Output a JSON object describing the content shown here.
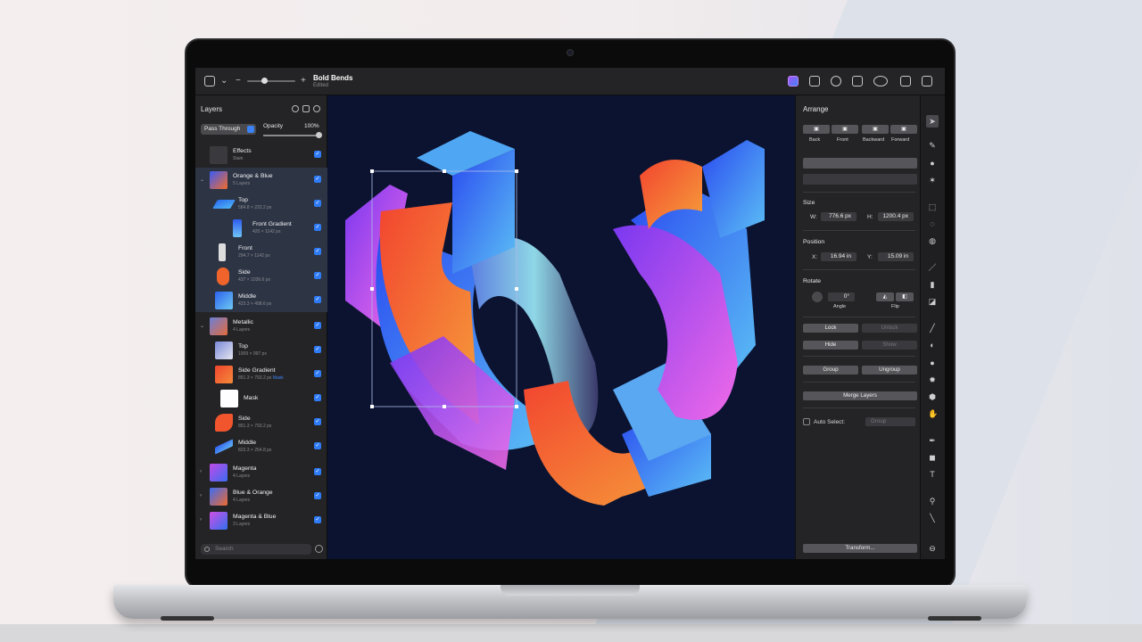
{
  "toolbar": {
    "doc_title": "Bold Bends",
    "doc_status": "Edited"
  },
  "layers_panel": {
    "header": "Layers",
    "blend_mode": "Pass Through",
    "opacity_label": "Opacity",
    "opacity_value": "100%",
    "search_placeholder": "Search",
    "items": [
      {
        "name": "Effects",
        "sub": "Stain"
      },
      {
        "name": "Orange & Blue",
        "sub": "5 Layers"
      },
      {
        "name": "Top",
        "sub": "584.8 × 222.2 px"
      },
      {
        "name": "Front Gradient",
        "sub": "420 × 1142 px"
      },
      {
        "name": "Front",
        "sub": "294.7 × 1142 px"
      },
      {
        "name": "Side",
        "sub": "437 × 1036.6 px"
      },
      {
        "name": "Middle",
        "sub": "423.3 × 498.6 px"
      },
      {
        "name": "Metallic",
        "sub": "4 Layers"
      },
      {
        "name": "Top",
        "sub": "1009 × 997 px"
      },
      {
        "name": "Side Gradient",
        "sub": "851.3 × 793.2 px",
        "tag": "Mask"
      },
      {
        "name": "Mask",
        "sub": ""
      },
      {
        "name": "Side",
        "sub": "851.3 × 793.2 px"
      },
      {
        "name": "Middle",
        "sub": "823.3 × 254.8 px"
      },
      {
        "name": "Magenta",
        "sub": "4 Layers"
      },
      {
        "name": "Blue & Orange",
        "sub": "4 Layers"
      },
      {
        "name": "Magenta & Blue",
        "sub": "3 Layers"
      }
    ]
  },
  "arrange_panel": {
    "header": "Arrange",
    "order_buttons": [
      "Back",
      "Front",
      "Backward",
      "Forward"
    ],
    "size_label": "Size",
    "w_label": "W:",
    "w_value": "776.6 px",
    "h_label": "H:",
    "h_value": "1200.4 px",
    "position_label": "Position",
    "x_label": "X:",
    "x_value": "16.94 in",
    "y_label": "Y:",
    "y_value": "15.09 in",
    "rotate_label": "Rotate",
    "angle_value": "0°",
    "angle_label": "Angle",
    "flip_label": "Flip",
    "lock": "Lock",
    "unlock": "Unlock",
    "hide": "Hide",
    "show": "Show",
    "group": "Group",
    "ungroup": "Ungroup",
    "merge": "Merge Layers",
    "auto_select": "Auto Select:",
    "auto_select_value": "Group",
    "transform": "Transform..."
  },
  "colors": {
    "accent": "#2f7bf5",
    "canvas_bg": "#0b1330"
  }
}
